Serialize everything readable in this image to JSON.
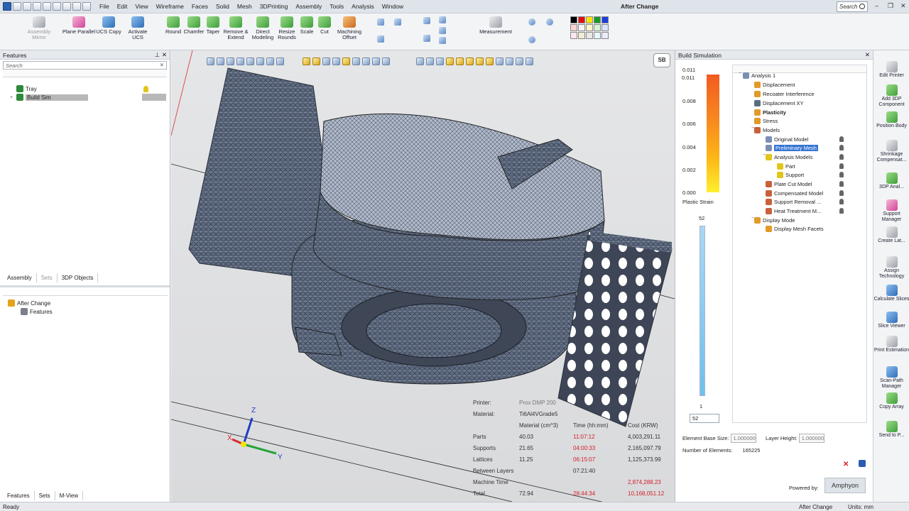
{
  "titlebar": {
    "menu": [
      "File",
      "Edit",
      "View",
      "Wireframe",
      "Faces",
      "Solid",
      "Mesh",
      "3DPrinting",
      "Assembly",
      "Tools",
      "Analysis",
      "Window"
    ],
    "window_title": "After Change",
    "search_placeholder": "Search"
  },
  "ribbon": {
    "assembly_mirror": "Assembly\nMirror",
    "plane_parallel": "Plane Parallel",
    "ucs_copy": "UCS Copy",
    "activate_ucs": "Activate UCS",
    "round": "Round",
    "chamfer": "Chamfer",
    "taper": "Taper",
    "remove_extend": "Remove &\nExtend",
    "direct_modeling": "Direct\nModeling",
    "resize_rounds": "Resize\nRounds",
    "scale": "Scale",
    "cut": "Cut",
    "machining_offset": "Machining\nOffset",
    "measurement": "Measurement"
  },
  "features_panel": {
    "title": "Features",
    "search_placeholder": "Search",
    "items": [
      {
        "label": "Tray"
      },
      {
        "label": "Build Sim"
      }
    ],
    "tabs": [
      "Assembly",
      "Sets",
      "3DP Objects"
    ],
    "history": [
      {
        "label": "After Change"
      },
      {
        "label": "Features"
      }
    ],
    "bottom_tabs": [
      "Features",
      "Sets",
      "M-View"
    ]
  },
  "viewport": {
    "logo": "SB",
    "axes": {
      "x": "X",
      "y": "Y",
      "z": "Z"
    },
    "stats": {
      "printer_label": "Printer:",
      "printer_value": "Prox DMP 200",
      "material_label": "Material:",
      "material_value": "Ti6Al4VGrade5",
      "headers": [
        "Material (cm^3)",
        "Time (hh:mm)",
        "Cost (KRW)"
      ],
      "rows": [
        {
          "name": "Parts",
          "material": "40.03",
          "time": "11:07:12",
          "cost": "4,003,291.11"
        },
        {
          "name": "Supports",
          "material": "21.65",
          "time": "04:00:33",
          "cost": "2,165,097.79"
        },
        {
          "name": "Lattices",
          "material": "11.25",
          "time": "06:15:07",
          "cost": "1,125,373.99"
        },
        {
          "name": "Between Layers",
          "material": "",
          "time": "07:21:40",
          "cost": ""
        },
        {
          "name": "Machine Time",
          "material": "",
          "time": "",
          "cost": "2,874,288.23"
        },
        {
          "name": "Total",
          "material": "72.94",
          "time": "28:44:34",
          "cost": "10,168,051.12"
        }
      ]
    }
  },
  "build_sim": {
    "title": "Build Simulation",
    "legend": {
      "max": "0.011",
      "v1": "0.008",
      "v2": "0.006",
      "v3": "0.004",
      "v4": "0.002",
      "min": "0.000",
      "label": "Plastic Strain"
    },
    "slider": {
      "top": "52",
      "bottom": "1",
      "value": "52",
      "level": 1.0
    },
    "tree": [
      {
        "label": "Analysis 1",
        "bold": false
      },
      {
        "label": "Displacement",
        "bold": false
      },
      {
        "label": "Recoater Interference",
        "bold": false
      },
      {
        "label": "Displacement XY",
        "bold": false
      },
      {
        "label": "Plasticity",
        "bold": true
      },
      {
        "label": "Stress",
        "bold": false
      },
      {
        "label": "Models",
        "bold": false
      },
      {
        "label": "Original Model",
        "bold": false
      },
      {
        "label": "Preliminary Mesh",
        "bold": false
      },
      {
        "label": "Analysis Models",
        "bold": false
      },
      {
        "label": "Part",
        "bold": false
      },
      {
        "label": "Support",
        "bold": false
      },
      {
        "label": "Plate Cut Model",
        "bold": false
      },
      {
        "label": "Compensated Model",
        "bold": false
      },
      {
        "label": "Support Removal ...",
        "bold": false
      },
      {
        "label": "Heat Treatment M...",
        "bold": false
      },
      {
        "label": "Display Mode",
        "bold": false
      },
      {
        "label": "Display Mesh Facets",
        "bold": false
      }
    ],
    "element_base_size_label": "Element Base Size:",
    "element_base_size": "1.000000",
    "layer_height_label": "Layer Height:",
    "layer_height": "1.000000",
    "num_elements_label": "Number of Elements:",
    "num_elements": "165225",
    "powered_by": "Powered by:",
    "amphyon": "Amphyon"
  },
  "right_toolbar": [
    "Edit Printer",
    "Add 3DP Component",
    "Position Body",
    "Shrinkage Compensat...",
    "3DP Anal...",
    "Support Manager",
    "Create Lat...",
    "Assign Technology",
    "Calculate Slices",
    "Slice Viewer",
    "Print Estimation",
    "Scan-Path Manager",
    "Copy Array",
    "Send to P..."
  ],
  "status": {
    "left": "Ready",
    "mid": "After Change",
    "units": "Units: mm"
  }
}
